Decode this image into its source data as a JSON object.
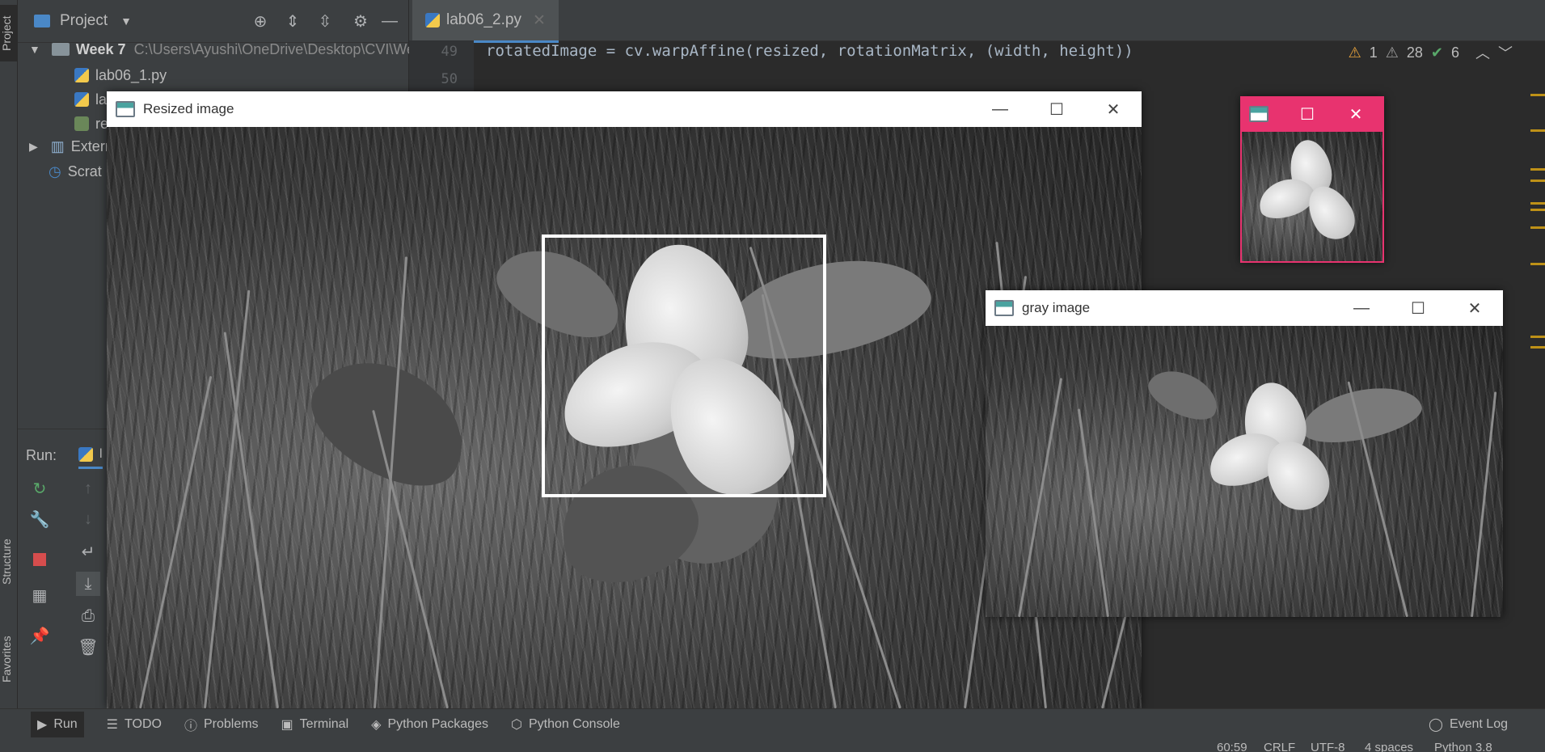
{
  "left_stripe": {
    "project_tab": "Project",
    "structure_tab": "Structure",
    "favorites_tab": "Favorites"
  },
  "project_panel": {
    "title": "Project",
    "tree": {
      "root_name": "Week 7",
      "root_path": "C:\\Users\\Ayushi\\OneDrive\\Desktop\\CVI\\We",
      "files": [
        "lab06_1.py",
        "la",
        "re"
      ],
      "external_libraries": "Extern",
      "scratches": "Scrat"
    }
  },
  "editor": {
    "active_tab": "lab06_2.py",
    "lines": [
      {
        "number": "49",
        "code": "rotatedImage = cv.warpAffine(resized, rotationMatrix, (width, height))"
      },
      {
        "number": "50",
        "code": ""
      }
    ],
    "inspections": {
      "warnings": "1",
      "weak_warnings": "28",
      "ok": "6"
    }
  },
  "run_panel": {
    "label": "Run:",
    "tab": "l"
  },
  "windows": {
    "resized": {
      "title": "Resized image"
    },
    "gray": {
      "title": "gray image"
    },
    "small": {
      "title": ""
    }
  },
  "bottom_bar": {
    "tabs": [
      "Run",
      "TODO",
      "Problems",
      "Terminal",
      "Python Packages",
      "Python Console"
    ],
    "event_log": "Event Log"
  },
  "status_bar": {
    "position": "60:59",
    "line_sep": "CRLF",
    "encoding": "UTF-8",
    "indent": "4 spaces",
    "interpreter": "Python 3.8"
  },
  "colors": {
    "accent": "#4a88c7",
    "active_window_title": "#e8336f"
  }
}
